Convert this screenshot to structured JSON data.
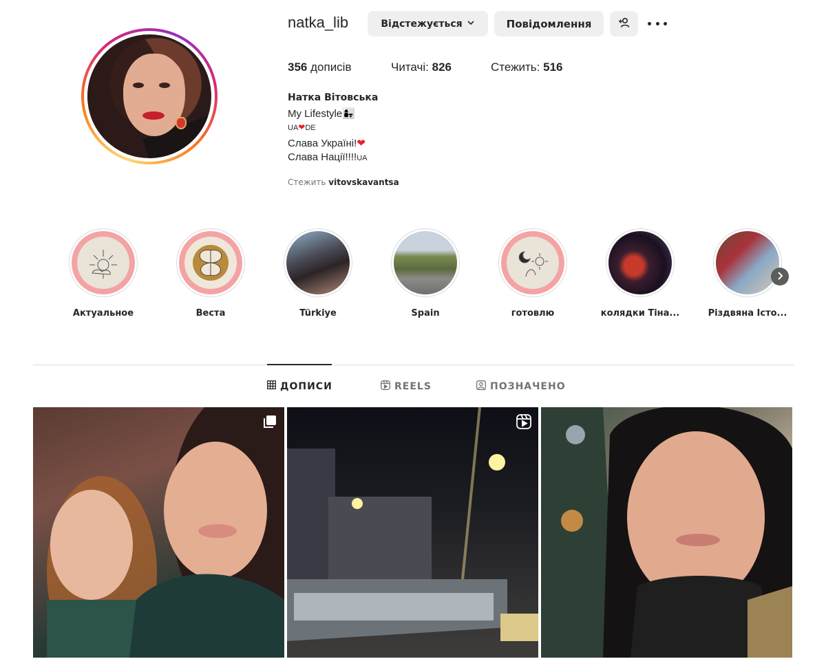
{
  "profile": {
    "username": "natka_lib",
    "following_button": "Відстежується",
    "message_button": "Повідомлення",
    "stats": {
      "posts_count": "356",
      "posts_label": "дописів",
      "followers_label": "Читачі:",
      "followers_count": "826",
      "following_label": "Стежить:",
      "following_count": "516"
    },
    "bio": {
      "name": "Натка Вітовська",
      "line1": "My Lifestyle",
      "line2_a": "UA",
      "line2_b": "DE",
      "line3": "Слава Україні!",
      "line4": "Слава Нації!!!!",
      "line4_flag": "UA"
    },
    "followed_by_label": "Стежить",
    "followed_by_user": "vitovskavantsa"
  },
  "highlights": [
    {
      "label": "Актуальное"
    },
    {
      "label": "Веста"
    },
    {
      "label": "Türkiye"
    },
    {
      "label": "Spain"
    },
    {
      "label": "готовлю"
    },
    {
      "label": "колядки Тіна..."
    },
    {
      "label": "Різдвяна Істо..."
    }
  ],
  "tabs": {
    "posts": "ДОПИСИ",
    "reels": "REELS",
    "tagged": "ПОЗНАЧЕНО",
    "active": "posts"
  },
  "icons": {
    "following_chevron": "chevron-down-icon",
    "add_user": "person-add-icon",
    "more": "more-horizontal-icon",
    "post1_badge": "carousel-icon",
    "post2_badge": "reels-icon"
  },
  "colors": {
    "button_bg": "#efefef",
    "text": "#262626",
    "muted": "#737373",
    "heart": "#e0262b"
  }
}
